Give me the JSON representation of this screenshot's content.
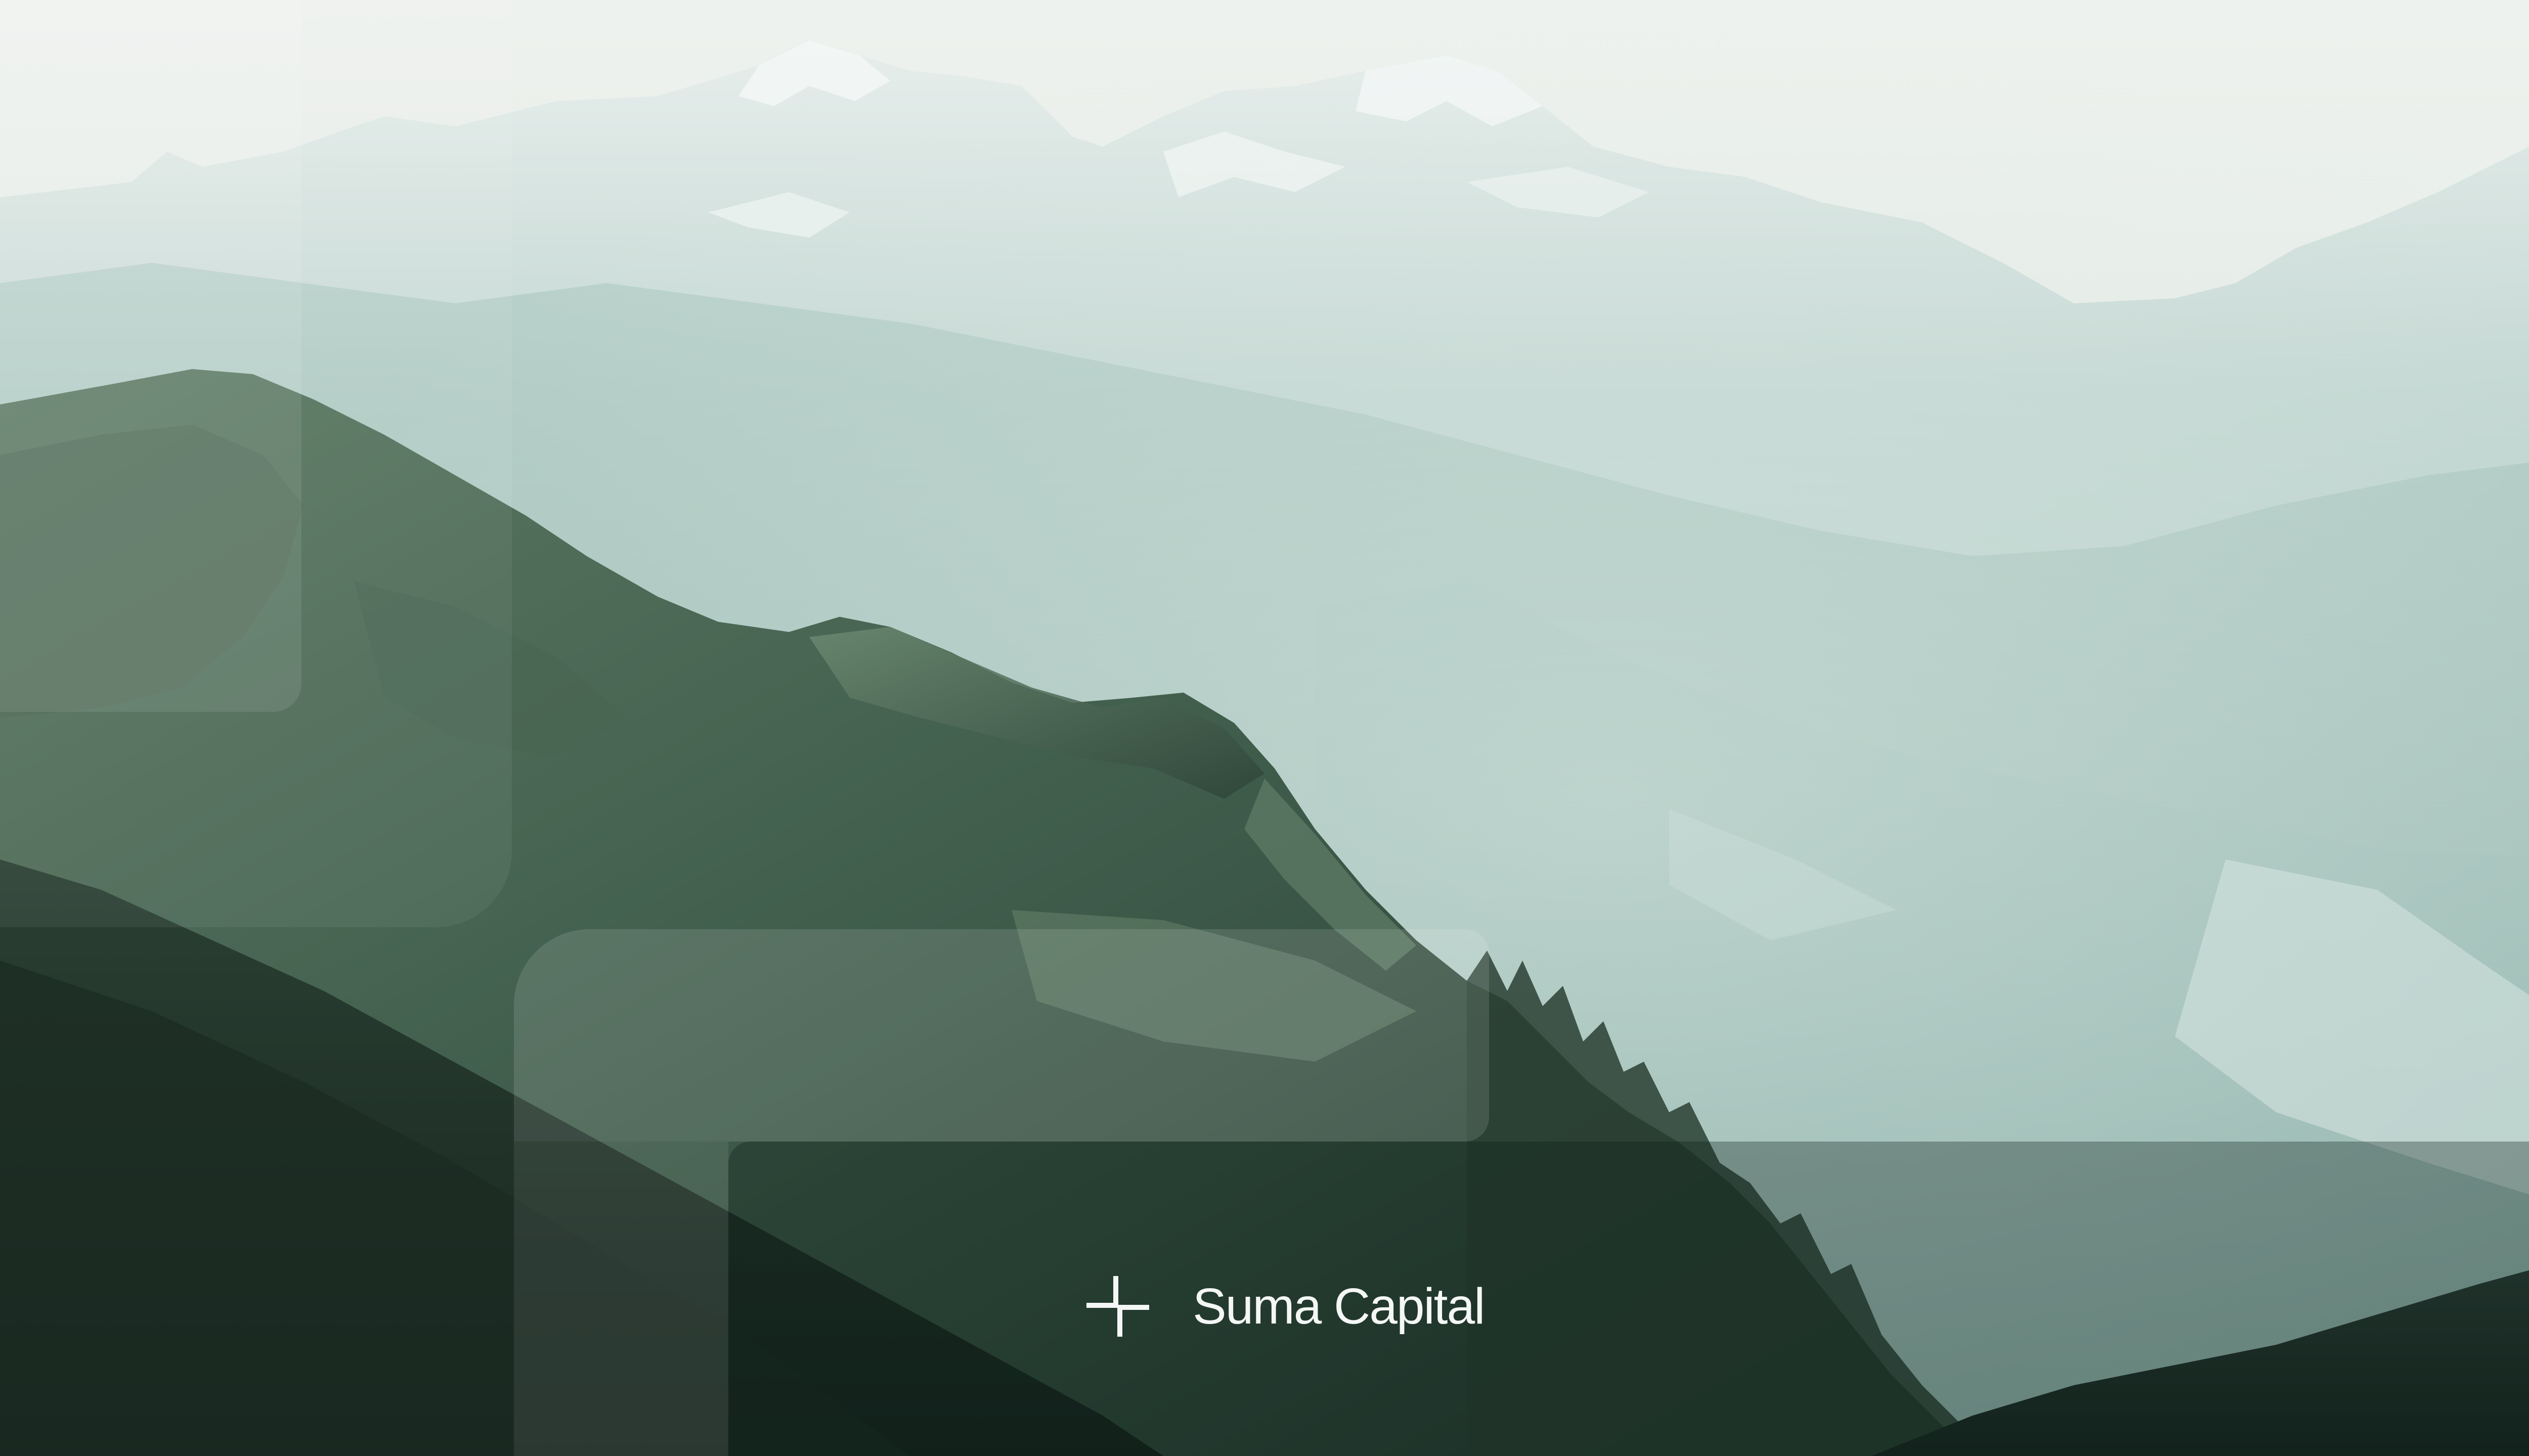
{
  "brand": {
    "name": "Suma Capital",
    "logo_icon": "suma-corner-mark-icon",
    "text_color": "#f4f7f5"
  },
  "background": {
    "subject": "mountain-range-photo",
    "sky_color": "#e9eee9",
    "far_mountain_color": "#b9d1cb",
    "mid_mountain_color": "#8fb2aa",
    "near_ridge_color": "#3f5a48",
    "foreground_color": "#1c2d24"
  }
}
